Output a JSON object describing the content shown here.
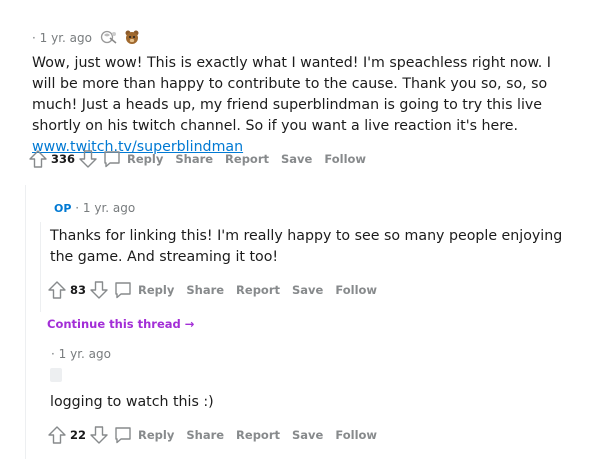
{
  "comments": [
    {
      "meta": {
        "separator": "·",
        "time": "1 yr. ago"
      },
      "awards": [
        "silver-award-icon",
        "bear-award-icon"
      ],
      "body": "Wow, just wow! This is exactly what I wanted! I'm speachless right now. I will be more than happy to contribute to the cause. Thank you so, so, so much! Just a heads up, my friend superblindman is going to try this live shortly on his twitch channel. So if you want a live reaction it's here. ",
      "link_text": "www.twitch.tv/superblindman",
      "score": "336",
      "actions": {
        "reply": "Reply",
        "share": "Share",
        "report": "Report",
        "save": "Save",
        "follow": "Follow"
      }
    },
    {
      "meta": {
        "op_badge": "OP",
        "separator": "·",
        "time": "1 yr. ago"
      },
      "body": "Thanks for linking this! I'm really happy to see so many people enjoying the game. And streaming it too!",
      "score": "83",
      "actions": {
        "reply": "Reply",
        "share": "Share",
        "report": "Report",
        "save": "Save",
        "follow": "Follow"
      }
    },
    {
      "meta": {
        "separator": "·",
        "time": "1 yr. ago"
      },
      "body": "logging to watch this :)",
      "score": "22",
      "actions": {
        "reply": "Reply",
        "share": "Share",
        "report": "Report",
        "save": "Save",
        "follow": "Follow"
      }
    }
  ],
  "continue_thread": {
    "label": "Continue this thread",
    "arrow": "→"
  },
  "colors": {
    "link": "#0079d3",
    "op": "#0079d3",
    "continue": "#a32ed7",
    "meta": "#787c7e",
    "action": "#878a8c"
  },
  "icons": {
    "upvote": "upvote-icon",
    "downvote": "downvote-icon",
    "reply": "reply-bubble-icon"
  }
}
